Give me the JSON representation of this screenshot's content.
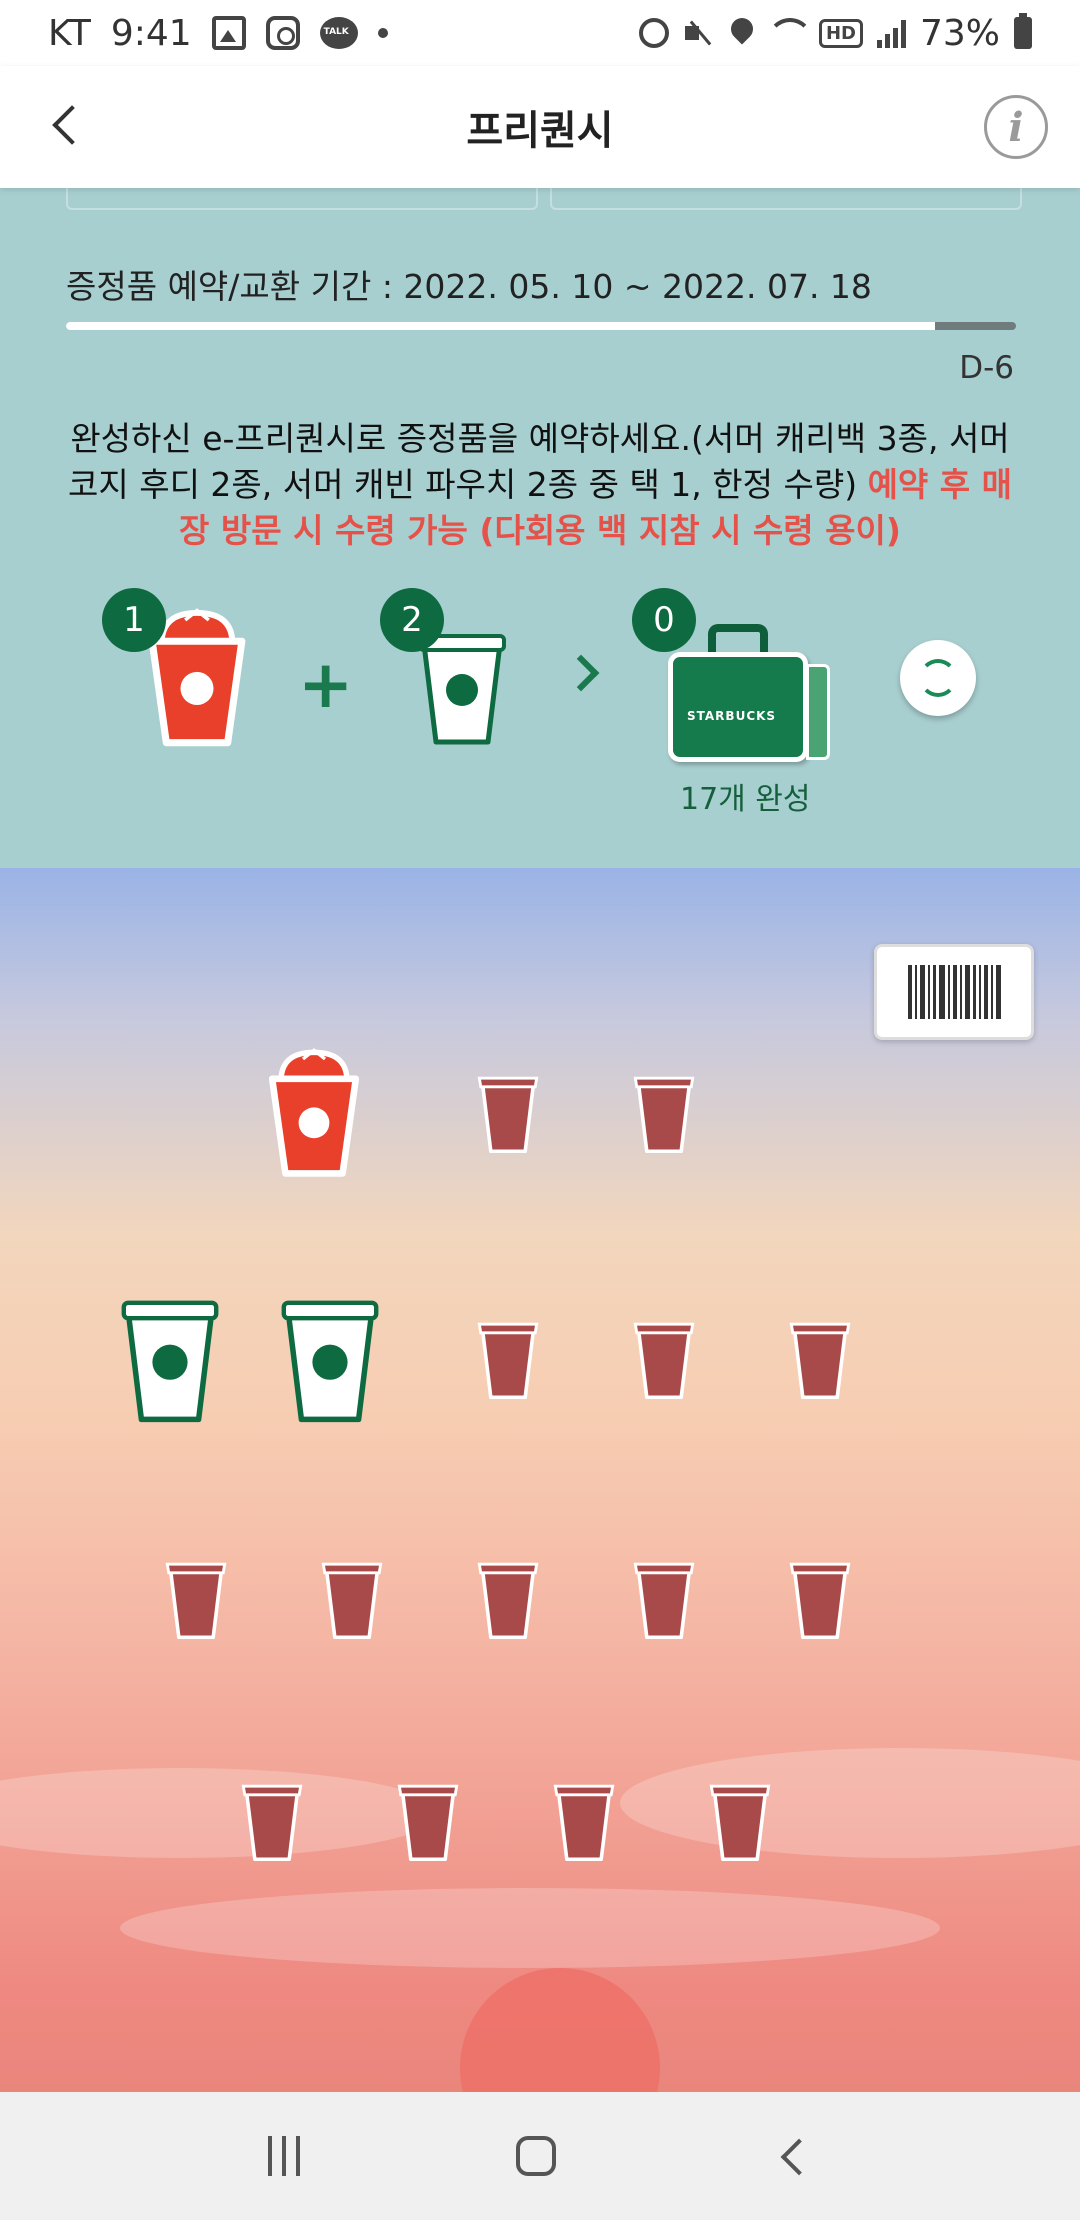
{
  "status_bar": {
    "carrier": "KT",
    "time": "9:41",
    "battery": "73%",
    "hd": "HD",
    "left_icons": [
      "image-icon",
      "instagram-icon",
      "kakaotalk-icon",
      "dot-icon"
    ],
    "right_icons": [
      "alarm-icon",
      "mute-icon",
      "location-icon",
      "wifi-icon",
      "hd-icon",
      "signal-icon",
      "battery-icon"
    ]
  },
  "header": {
    "title": "프리퀀시",
    "back_icon": "chevron-left-icon",
    "info_icon": "info-icon",
    "info_glyph": "i"
  },
  "panel": {
    "period": "증정품 예약/교환 기간 : 2022. 05. 10 ~ 2022. 07. 18",
    "progress": 0.915,
    "dday": "D-6",
    "desc_main": "완성하신 e-프리퀀시로 증정품을 예약하세요.(서머 캐리백 3종, 서머 코지 후디 2종, 서머 캐빈 파우치 2종 중 택 1, 한정 수량) ",
    "desc_red": "예약 후 매장 방문 시 수령 가능 (다회용 백 지참 시 수령 용이)",
    "combo": {
      "red_count": "1",
      "plus": "+",
      "green_count": "2",
      "bag_count": "0",
      "bag_brand": "STARBUCKS",
      "bag_label": "17개 완성"
    }
  },
  "colors": {
    "panel_bg": "#a8cfd0",
    "brand_green": "#0e6a40",
    "red_text": "#e5524a",
    "cup_empty": "#a84a4a",
    "cup_red": "#e8402a"
  },
  "board": {
    "stamps": [
      {
        "kind": "red",
        "filled": true
      },
      {
        "kind": "empty",
        "filled": false
      },
      {
        "kind": "empty",
        "filled": false
      },
      {
        "kind": "green",
        "filled": true
      },
      {
        "kind": "green",
        "filled": true
      },
      {
        "kind": "empty",
        "filled": false
      },
      {
        "kind": "empty",
        "filled": false
      },
      {
        "kind": "empty",
        "filled": false
      },
      {
        "kind": "empty",
        "filled": false
      },
      {
        "kind": "empty",
        "filled": false
      },
      {
        "kind": "empty",
        "filled": false
      },
      {
        "kind": "empty",
        "filled": false
      },
      {
        "kind": "empty",
        "filled": false
      },
      {
        "kind": "empty",
        "filled": false
      },
      {
        "kind": "empty",
        "filled": false
      },
      {
        "kind": "empty",
        "filled": false
      },
      {
        "kind": "empty",
        "filled": false
      }
    ],
    "barcode_icon": "barcode-icon"
  },
  "navbar": {
    "back_icon": "nav-back-icon",
    "home_icon": "nav-home-icon",
    "recent_icon": "nav-recent-icon"
  }
}
